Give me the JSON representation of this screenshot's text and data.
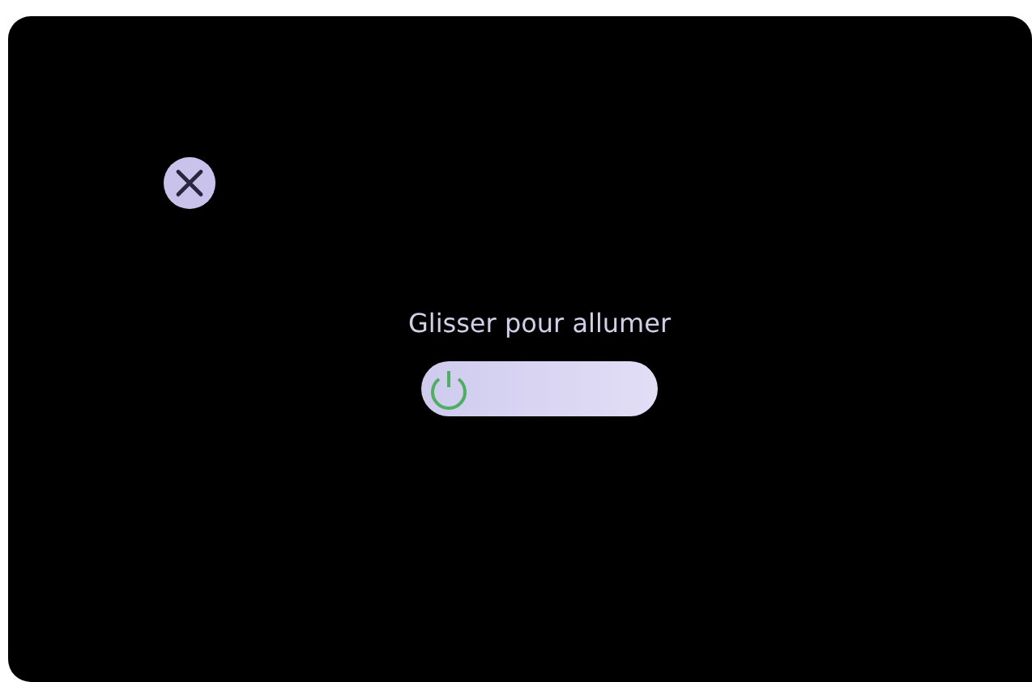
{
  "prompt": "Glisser pour allumer",
  "slider": {
    "level": 0
  }
}
